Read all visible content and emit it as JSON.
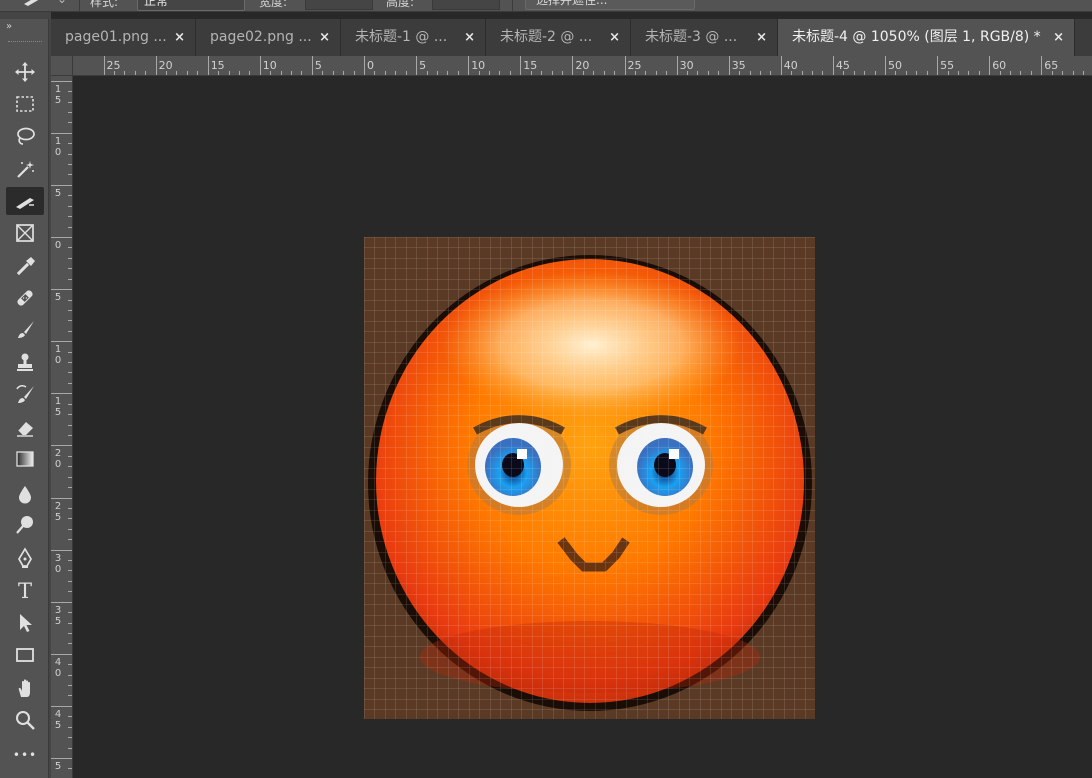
{
  "options_bar": {
    "style_label": "样式:",
    "style_value": "正常",
    "width_label": "宽度:",
    "height_label": "高度:",
    "select_subject_label": "选择并遮住..."
  },
  "tabs": [
    {
      "label": "page01.png ...",
      "close": "×",
      "active": false
    },
    {
      "label": "page02.png ...",
      "close": "×",
      "active": false
    },
    {
      "label": "未标题-1 @ ...",
      "close": "×",
      "active": false
    },
    {
      "label": "未标题-2 @ ...",
      "close": "×",
      "active": false
    },
    {
      "label": "未标题-3 @ ...",
      "close": "×",
      "active": false
    },
    {
      "label": "未标题-4 @ 1050% (图层 1, RGB/8) *",
      "close": "×",
      "active": true
    }
  ],
  "toolbar": {
    "collapse_glyph": "»",
    "tools": [
      {
        "name": "move-tool",
        "icon": "move-icon"
      },
      {
        "name": "marquee-tool",
        "icon": "rectangular-marquee-icon"
      },
      {
        "name": "lasso-tool",
        "icon": "lasso-icon"
      },
      {
        "name": "magic-wand-tool",
        "icon": "magic-wand-icon"
      },
      {
        "name": "slice-tool",
        "icon": "slice-icon",
        "active": true
      },
      {
        "name": "frame-tool",
        "icon": "frame-icon"
      },
      {
        "name": "eyedropper-tool",
        "icon": "eyedropper-icon"
      },
      {
        "name": "healing-brush-tool",
        "icon": "bandage-icon"
      },
      {
        "name": "brush-tool",
        "icon": "brush-icon"
      },
      {
        "name": "clone-stamp-tool",
        "icon": "stamp-icon"
      },
      {
        "name": "history-brush-tool",
        "icon": "history-brush-icon"
      },
      {
        "name": "eraser-tool",
        "icon": "eraser-icon"
      },
      {
        "name": "gradient-tool",
        "icon": "gradient-icon"
      },
      {
        "name": "blur-tool",
        "icon": "drop-icon"
      },
      {
        "name": "dodge-tool",
        "icon": "dodge-icon"
      },
      {
        "name": "pen-tool",
        "icon": "pen-icon"
      },
      {
        "name": "type-tool",
        "icon": "type-icon",
        "glyph": "T"
      },
      {
        "name": "path-selection-tool",
        "icon": "arrow-cursor-icon"
      },
      {
        "name": "rectangle-tool",
        "icon": "rectangle-icon"
      },
      {
        "name": "hand-tool",
        "icon": "hand-icon"
      },
      {
        "name": "zoom-tool",
        "icon": "zoom-icon"
      },
      {
        "name": "more-tools",
        "icon": "ellipsis-icon",
        "glyph": "•••"
      }
    ]
  },
  "ruler_h": {
    "labels": [
      "25",
      "20",
      "15",
      "10",
      "5",
      "0",
      "5",
      "10",
      "15",
      "20",
      "25",
      "30",
      "35",
      "40",
      "45",
      "50",
      "55",
      "60",
      "65"
    ]
  },
  "ruler_v": {
    "labels": [
      "1\n5",
      "1\n0",
      "5",
      "0",
      "5",
      "1\n0",
      "1\n5",
      "2\n0",
      "2\n5",
      "3\n0",
      "3\n5",
      "4\n0",
      "4\n5",
      "5"
    ]
  },
  "colors": {
    "workspace": "#282828",
    "panel": "#535353",
    "active_tab": "#535353",
    "inactive_tab": "#3c3c3c",
    "face_orange": "#ff7a00",
    "face_red": "#e83a10",
    "pixel_bg": "#5a3a24",
    "grid_line": "#ffffff",
    "eye_blue": "#1aa0f0"
  }
}
